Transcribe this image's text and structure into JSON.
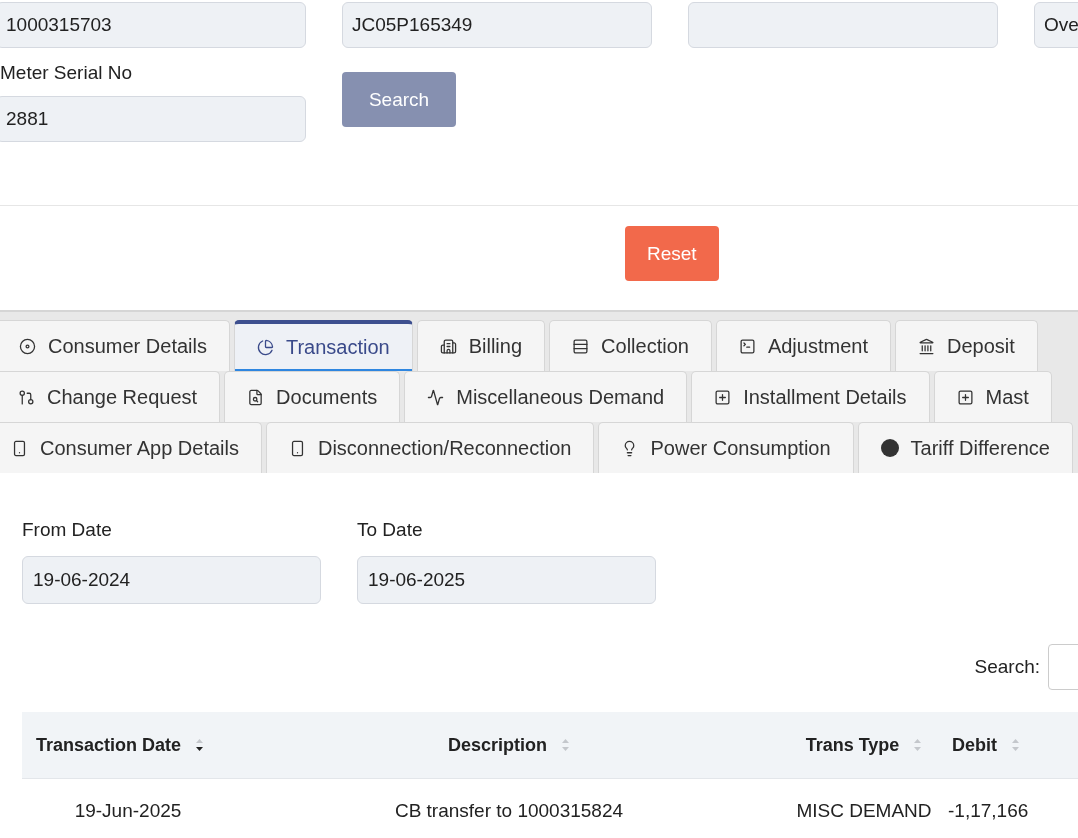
{
  "top_fields": [
    {
      "kind": "filled",
      "value": "1000315703"
    },
    {
      "kind": "filled",
      "value": "JC05P165349"
    },
    {
      "kind": "blank"
    },
    {
      "kind": "filled",
      "value": "Ove"
    }
  ],
  "meter_serial": {
    "label": "Meter Serial No",
    "value": "2881"
  },
  "search_button": {
    "label": "Search"
  },
  "reset_button": {
    "label": "Reset"
  },
  "tab_rows": [
    [
      {
        "label": "Consumer Details",
        "selected": false
      },
      {
        "label": "Transaction",
        "selected": true
      },
      {
        "label": "Billing",
        "selected": false
      },
      {
        "label": "Collection",
        "selected": false
      },
      {
        "label": "Adjustment",
        "selected": false
      },
      {
        "label": "Deposit",
        "selected": false
      }
    ],
    [
      {
        "label": "Change Request",
        "selected": false
      },
      {
        "label": "Documents",
        "selected": false
      },
      {
        "label": "Miscellaneous Demand",
        "selected": false
      },
      {
        "label": "Installment Details",
        "selected": false
      },
      {
        "label": "Mast",
        "selected": false
      }
    ],
    [
      {
        "label": "Consumer App Details",
        "selected": false
      },
      {
        "label": "Disconnection/Reconnection",
        "selected": false
      },
      {
        "label": "Power Consumption",
        "selected": false
      },
      {
        "label": "Tariff Difference",
        "selected": false
      }
    ]
  ],
  "date_filters": [
    {
      "label": "From Date",
      "value": "19-06-2024"
    },
    {
      "label": "To Date",
      "value": "19-06-2025"
    }
  ],
  "table_search": {
    "label": "Search:"
  },
  "table": {
    "columns": [
      {
        "label": "Transaction Date",
        "sorted": true
      },
      {
        "label": "Description",
        "sorted": false
      },
      {
        "label": "Trans Type",
        "sorted": false
      },
      {
        "label": "Debit",
        "sorted": false
      }
    ],
    "rows": [
      [
        "19-Jun-2025",
        "CB transfer to 1000315824",
        "MISC DEMAND",
        "-1,17,166"
      ]
    ]
  }
}
